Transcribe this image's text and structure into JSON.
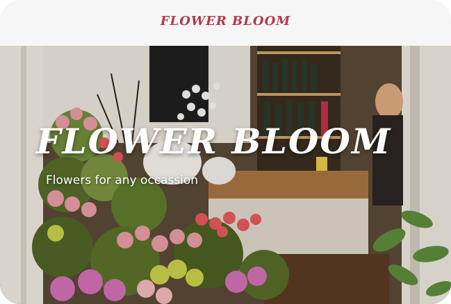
{
  "header": {
    "brand": "FLOWER BLOOM"
  },
  "hero": {
    "title": "FLOWER BLOOM",
    "subtitle": "Flowers for any occassion",
    "image_description_icon": "flower-shop-photo"
  },
  "colors": {
    "brand": "#b03a4a",
    "header_bg": "#f7f6f6",
    "hero_text": "#ffffff"
  }
}
